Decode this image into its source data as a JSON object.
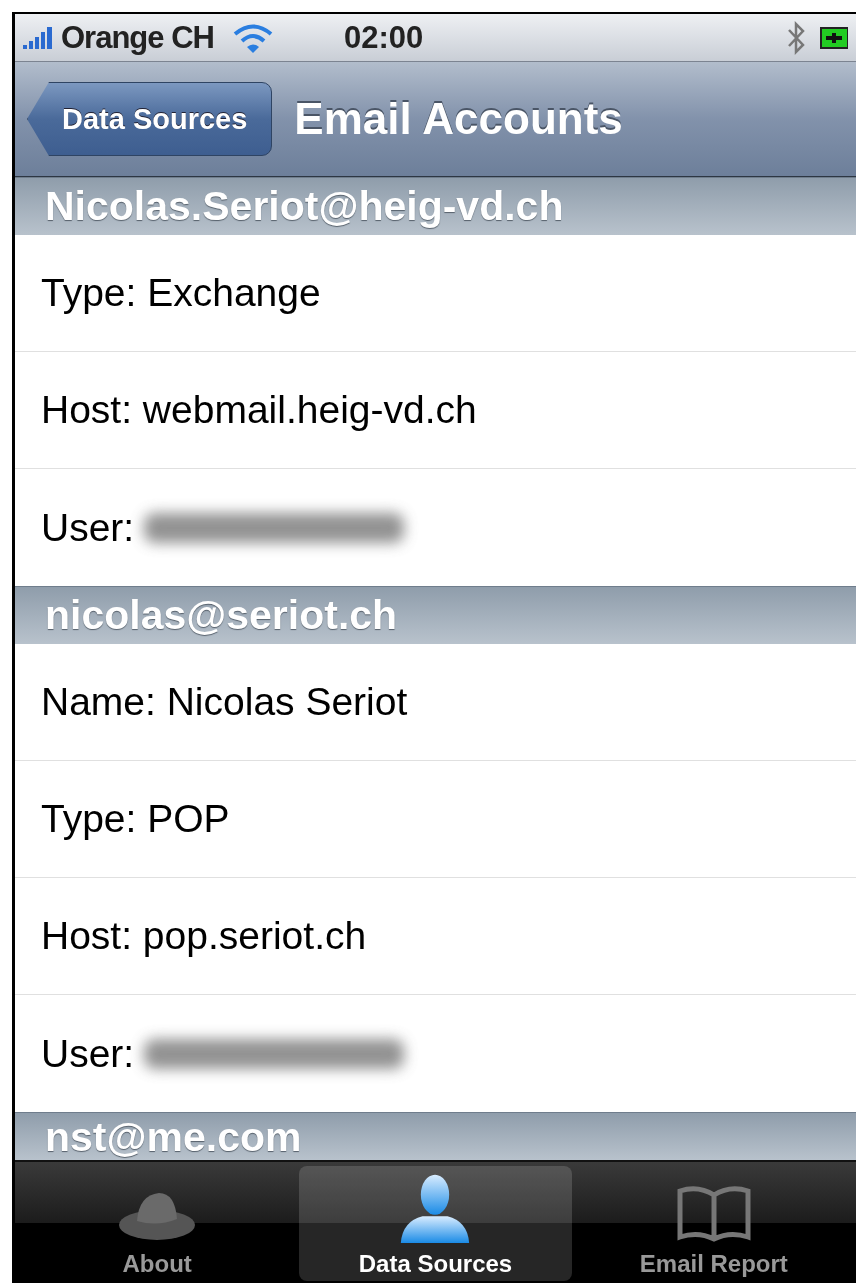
{
  "status_bar": {
    "carrier": "Orange CH",
    "time": "02:00"
  },
  "nav_bar": {
    "back_button": "Data Sources",
    "title": "Email Accounts"
  },
  "sections": [
    {
      "header": "Nicolas.Seriot@heig-vd.ch",
      "rows": [
        {
          "label": "Type: Exchange",
          "blurred": false
        },
        {
          "label": "Host: webmail.heig-vd.ch",
          "blurred": false
        },
        {
          "label": "User:",
          "blurred": true
        }
      ]
    },
    {
      "header": "nicolas@seriot.ch",
      "rows": [
        {
          "label": "Name: Nicolas Seriot",
          "blurred": false
        },
        {
          "label": "Type: POP",
          "blurred": false
        },
        {
          "label": "Host: pop.seriot.ch",
          "blurred": false
        },
        {
          "label": "User:",
          "blurred": true
        }
      ]
    },
    {
      "header": "nst@me.com"
    }
  ],
  "tab_bar": [
    {
      "label": "About",
      "kind": "hat",
      "selected": false
    },
    {
      "label": "Data Sources",
      "kind": "person",
      "selected": true
    },
    {
      "label": "Email Report",
      "kind": "book",
      "selected": false
    }
  ]
}
